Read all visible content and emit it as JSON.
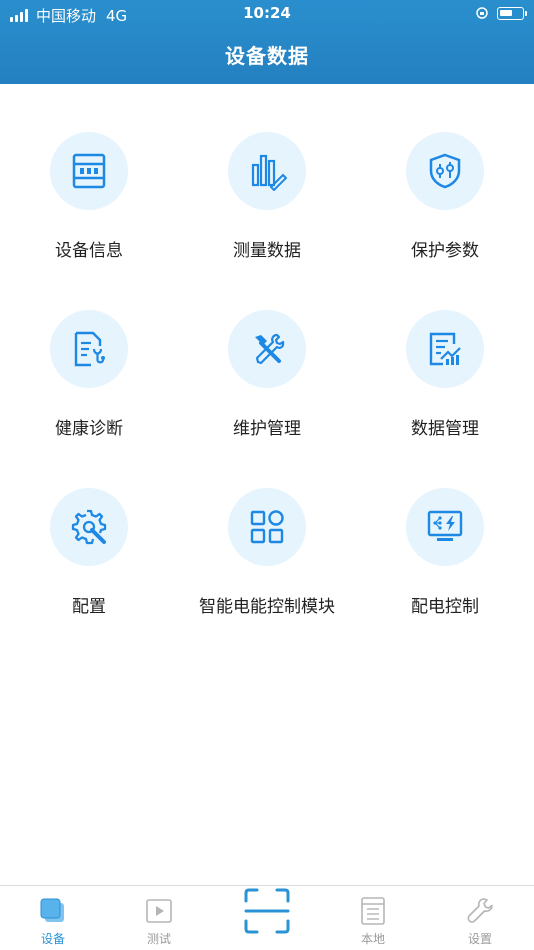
{
  "status": {
    "carrier": "中国移动",
    "network": "4G",
    "time": "10:24"
  },
  "header": {
    "title": "设备数据"
  },
  "menu": [
    {
      "label": "设备信息",
      "icon": "device-info-icon"
    },
    {
      "label": "测量数据",
      "icon": "measure-chart-icon"
    },
    {
      "label": "保护参数",
      "icon": "shield-params-icon"
    },
    {
      "label": "健康诊断",
      "icon": "health-diagnosis-icon"
    },
    {
      "label": "维护管理",
      "icon": "maintenance-tools-icon"
    },
    {
      "label": "数据管理",
      "icon": "data-management-icon"
    },
    {
      "label": "配置",
      "icon": "config-gear-icon"
    },
    {
      "label": "智能电能控制模块",
      "icon": "modules-grid-icon"
    },
    {
      "label": "配电控制",
      "icon": "power-control-icon"
    }
  ],
  "tabbar": {
    "tabs": [
      {
        "label": "设备",
        "active": true
      },
      {
        "label": "测试",
        "active": false
      },
      {
        "label": "本地",
        "active": false
      },
      {
        "label": "设置",
        "active": false
      }
    ]
  },
  "colors": {
    "header": "#2480c0",
    "accent": "#2a93d5",
    "icon_bg": "#e6f4fd"
  }
}
